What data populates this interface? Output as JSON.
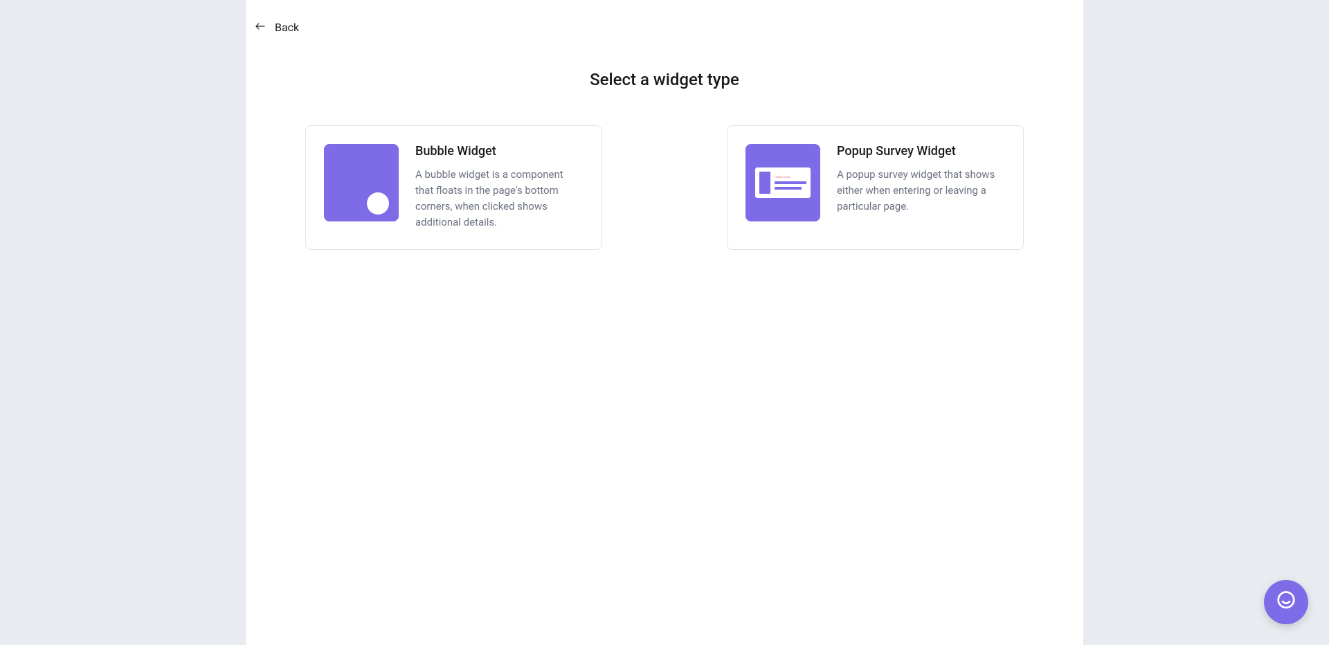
{
  "nav": {
    "back_label": "Back"
  },
  "page": {
    "title": "Select a widget type"
  },
  "widgets": [
    {
      "title": "Bubble Widget",
      "description": "A bubble widget is a component that floats in the page's bottom corners, when clicked shows additional details."
    },
    {
      "title": "Popup Survey Widget",
      "description": "A popup survey widget that shows either when entering or leaving a particular page."
    }
  ],
  "popup_preview": {
    "heading_text": "Heading text"
  }
}
